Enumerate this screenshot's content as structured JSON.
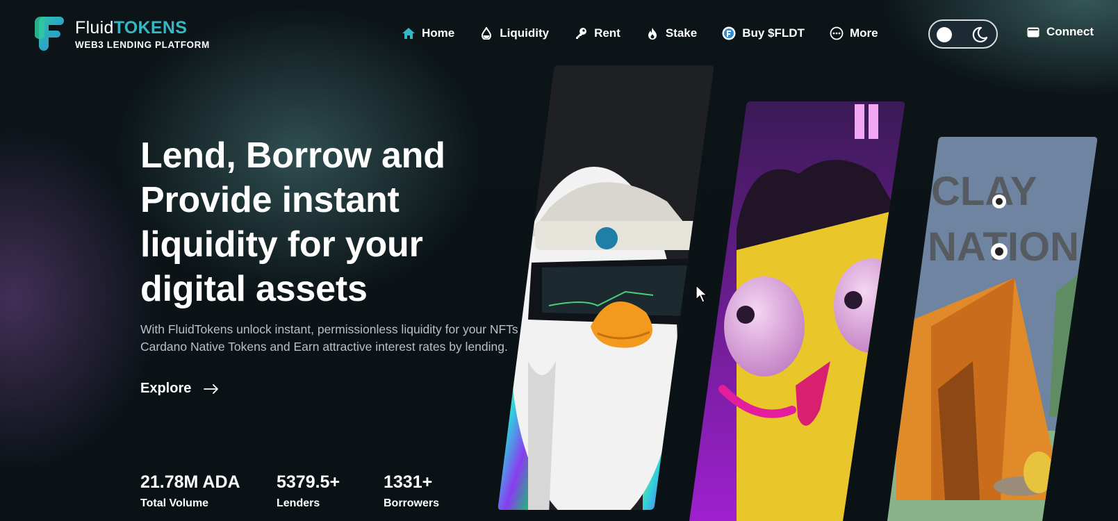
{
  "brand": {
    "name_part1": "Fluid",
    "name_part2": "TOKENS",
    "tagline": "WEB3 LENDING PLATFORM",
    "accent_color": "#33b8c4"
  },
  "nav": {
    "items": [
      {
        "label": "Home",
        "icon": "home-icon",
        "active": true
      },
      {
        "label": "Liquidity",
        "icon": "droplet-icon"
      },
      {
        "label": "Rent",
        "icon": "key-icon"
      },
      {
        "label": "Stake",
        "icon": "flame-icon"
      },
      {
        "label": "Buy $FLDT",
        "icon": "fldt-token-icon"
      },
      {
        "label": "More",
        "icon": "more-dots-icon"
      }
    ],
    "theme_toggle": {
      "mode": "dark",
      "icon": "moon-icon"
    },
    "connect_label": "Connect"
  },
  "hero": {
    "title": "Lend, Borrow and Provide instant liquidity for your digital assets",
    "subtitle_line1": "With FluidTokens unlock instant, permissionless liquidity for your NFTs",
    "subtitle_line2": "Cardano Native Tokens and Earn attractive interest rates by lending.",
    "cta_label": "Explore"
  },
  "stats": [
    {
      "value": "21.78M ADA",
      "label": "Total Volume"
    },
    {
      "value": "5379.5+",
      "label": "Lenders"
    },
    {
      "value": "1331+",
      "label": "Borrowers"
    }
  ],
  "nft_cards": [
    {
      "subject": "penguin with beanie and VR visor"
    },
    {
      "subject": "yellow bird character with pink beak"
    },
    {
      "subject": "clay tent with CLAYNATION lettering",
      "lettering": "CLAY NATION"
    }
  ]
}
